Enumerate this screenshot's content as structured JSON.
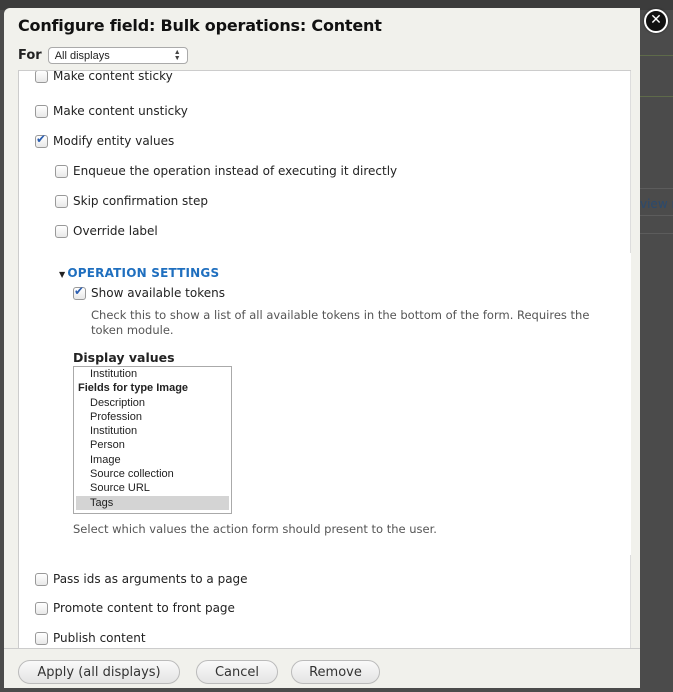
{
  "dialog": {
    "title": "Configure field: Bulk operations: Content",
    "for_label": "For",
    "for_select": {
      "value": "All displays"
    },
    "close_icon": "close-circle-icon"
  },
  "operations": [
    {
      "label": "Make content sticky",
      "checked": false,
      "partial": true
    },
    {
      "label": "Make content unsticky",
      "checked": false
    },
    {
      "label": "Modify entity values",
      "checked": true
    }
  ],
  "sub_options": [
    {
      "label": "Enqueue the operation instead of executing it directly",
      "checked": false
    },
    {
      "label": "Skip confirmation step",
      "checked": false
    },
    {
      "label": "Override label",
      "checked": false
    }
  ],
  "operation_settings": {
    "legend": "OPERATION SETTINGS",
    "show_tokens": {
      "label": "Show available tokens",
      "checked": true
    },
    "show_tokens_desc": "Check this to show a list of all available tokens in the bottom of the form. Requires the token module.",
    "display_values_label": "Display values",
    "display_values_options": [
      {
        "label": "Institution",
        "group": false,
        "selected": false
      },
      {
        "label": "Fields for type Image",
        "group": true,
        "selected": false
      },
      {
        "label": "Description",
        "group": false,
        "selected": false
      },
      {
        "label": "Profession",
        "group": false,
        "selected": false
      },
      {
        "label": "Institution",
        "group": false,
        "selected": false
      },
      {
        "label": "Person",
        "group": false,
        "selected": false
      },
      {
        "label": "Image",
        "group": false,
        "selected": false
      },
      {
        "label": "Source collection",
        "group": false,
        "selected": false
      },
      {
        "label": "Source URL",
        "group": false,
        "selected": false
      },
      {
        "label": "Tags",
        "group": false,
        "selected": true
      }
    ],
    "display_values_desc": "Select which values the action form should present to the user."
  },
  "more_operations": [
    {
      "label": "Pass ids as arguments to a page",
      "checked": false
    },
    {
      "label": "Promote content to front page",
      "checked": false
    },
    {
      "label": "Publish content",
      "checked": false
    }
  ],
  "buttons": {
    "apply": "Apply (all displays)",
    "cancel": "Cancel",
    "remove": "Remove"
  },
  "background": {
    "partial_link": "view n"
  }
}
